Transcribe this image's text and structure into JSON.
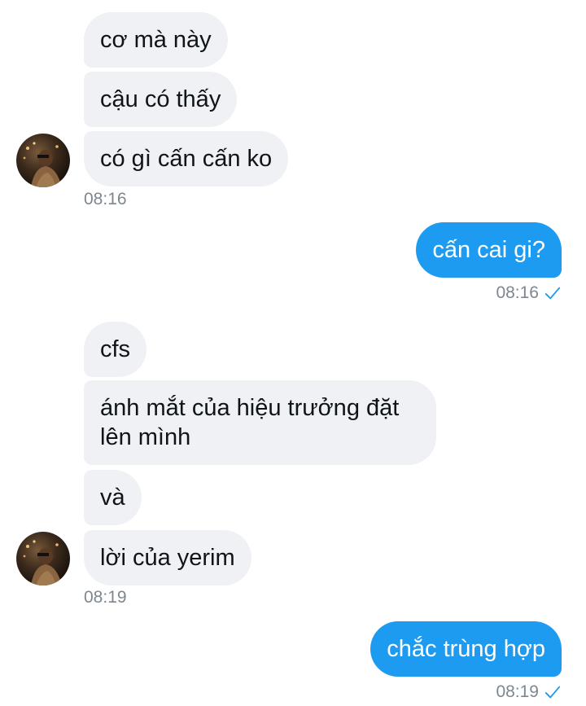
{
  "messages": {
    "group1": {
      "bubbles": [
        "cơ mà này",
        "cậu có thấy",
        "có gì cấn cấn ko"
      ],
      "time": "08:16"
    },
    "out1": {
      "text": "cấn cai gi?",
      "time": "08:16"
    },
    "group2": {
      "bubbles": [
        "cfs",
        "ánh mắt của hiệu trưởng đặt lên mình",
        "và",
        "lời của yerim"
      ],
      "time": "08:19"
    },
    "out2": {
      "text": "chắc trùng hợp",
      "time": "08:19"
    }
  },
  "icons": {
    "read_check": "check-icon",
    "avatar": "avatar"
  },
  "colors": {
    "incoming_bubble": "#eff1f4",
    "outgoing_bubble": "#1d9bf0",
    "timestamp": "#7d8790",
    "check": "#1d9bf0"
  }
}
